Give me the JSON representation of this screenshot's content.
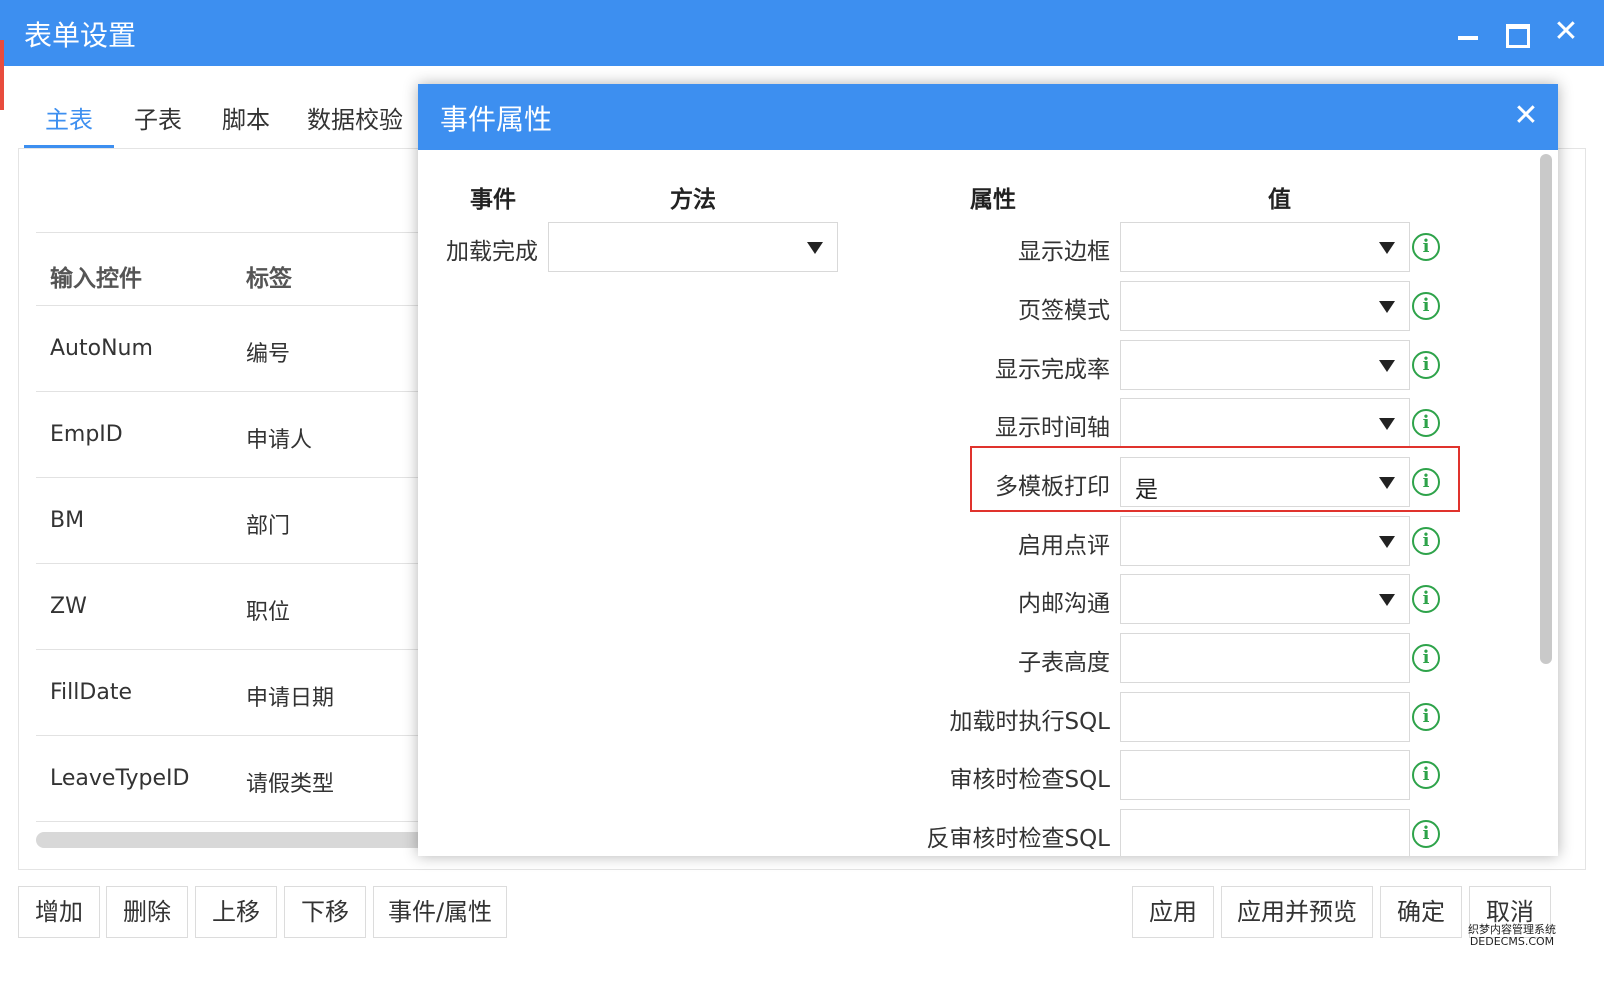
{
  "window": {
    "title": "表单设置"
  },
  "tabs": [
    {
      "label": "主表"
    },
    {
      "label": "子表"
    },
    {
      "label": "脚本"
    },
    {
      "label": "数据校验"
    }
  ],
  "grid": {
    "columns": [
      "输入控件",
      "标签"
    ],
    "rows": [
      {
        "control": "AutoNum",
        "label": "编号"
      },
      {
        "control": "EmpID",
        "label": "申请人"
      },
      {
        "control": "BM",
        "label": "部门"
      },
      {
        "control": "ZW",
        "label": "职位"
      },
      {
        "control": "FillDate",
        "label": "申请日期"
      },
      {
        "control": "LeaveTypeID",
        "label": "请假类型"
      }
    ]
  },
  "toolbar_left": [
    {
      "label": "增加"
    },
    {
      "label": "删除"
    },
    {
      "label": "上移"
    },
    {
      "label": "下移"
    },
    {
      "label": "事件/属性"
    }
  ],
  "toolbar_right": [
    {
      "label": "应用"
    },
    {
      "label": "应用并预览"
    },
    {
      "label": "确定"
    },
    {
      "label": "取消"
    }
  ],
  "dialog": {
    "title": "事件属性",
    "headers": {
      "event": "事件",
      "method": "方法",
      "property": "属性",
      "value": "值"
    },
    "event": {
      "label": "加载完成",
      "value": ""
    },
    "properties": [
      {
        "label": "显示边框",
        "value": "",
        "dropdown": true
      },
      {
        "label": "页签模式",
        "value": "",
        "dropdown": true
      },
      {
        "label": "显示完成率",
        "value": "",
        "dropdown": true
      },
      {
        "label": "显示时间轴",
        "value": "",
        "dropdown": true
      },
      {
        "label": "多模板打印",
        "value": "是",
        "dropdown": true,
        "highlighted": true
      },
      {
        "label": "启用点评",
        "value": "",
        "dropdown": true
      },
      {
        "label": "内邮沟通",
        "value": "",
        "dropdown": true
      },
      {
        "label": "子表高度",
        "value": "",
        "dropdown": false
      },
      {
        "label": "加载时执行SQL",
        "value": "",
        "dropdown": false
      },
      {
        "label": "审核时检查SQL",
        "value": "",
        "dropdown": false
      },
      {
        "label": "反审核时检查SQL",
        "value": "",
        "dropdown": false
      }
    ],
    "info_icon_glyph": "i",
    "highlight_color": "#e0332d"
  },
  "watermark": {
    "line1": "织梦内容管理系统",
    "line2": "DEDECMS.COM"
  },
  "colors": {
    "accent": "#3d8ff0",
    "info": "#2ea34a"
  }
}
